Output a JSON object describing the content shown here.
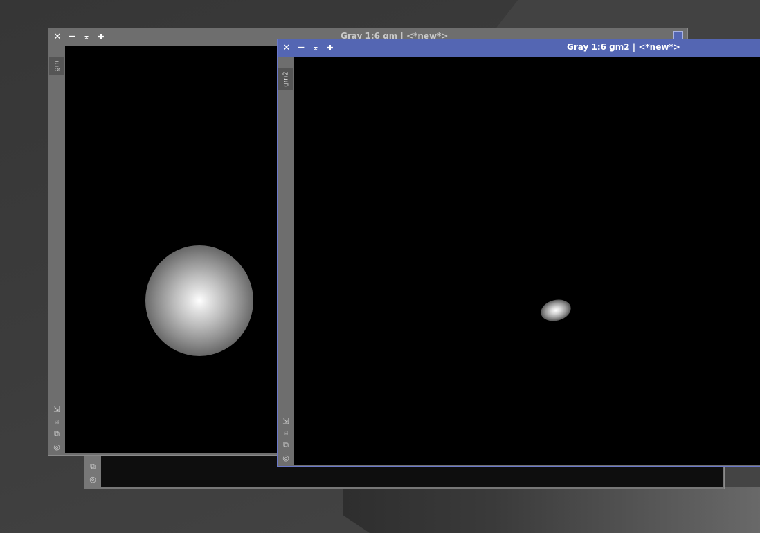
{
  "colors": {
    "active_titlebar": "#5466b3",
    "inactive_titlebar": "#6e6e6e",
    "image_bg": "#000000"
  },
  "window_back": {
    "tools": [
      {
        "icon": "crop-icon",
        "glyph": "⌑"
      },
      {
        "icon": "clone-icon",
        "glyph": "⧉"
      },
      {
        "icon": "target-icon",
        "glyph": "◎"
      }
    ]
  },
  "window_gm": {
    "title": "Gray 1:6 gm | <*new*>",
    "tab_label": "gm",
    "buttons": {
      "close": "✕",
      "minimize": "−",
      "shade": "⌅",
      "maximize": "✚"
    },
    "tools": [
      {
        "icon": "fit-view-icon",
        "glyph": "⇲"
      },
      {
        "icon": "crop-icon",
        "glyph": "⌑"
      },
      {
        "icon": "clone-icon",
        "glyph": "⧉"
      },
      {
        "icon": "target-icon",
        "glyph": "◎"
      }
    ]
  },
  "window_gm2": {
    "title": "Gray 1:6 gm2 | <*new*>",
    "tab_label": "gm2",
    "buttons": {
      "close": "✕",
      "minimize": "−",
      "shade": "⌅",
      "maximize": "✚"
    },
    "tools": [
      {
        "icon": "fit-view-icon",
        "glyph": "⇲"
      },
      {
        "icon": "crop-icon",
        "glyph": "⌑"
      },
      {
        "icon": "clone-icon",
        "glyph": "⧉"
      },
      {
        "icon": "target-icon",
        "glyph": "◎"
      }
    ]
  }
}
